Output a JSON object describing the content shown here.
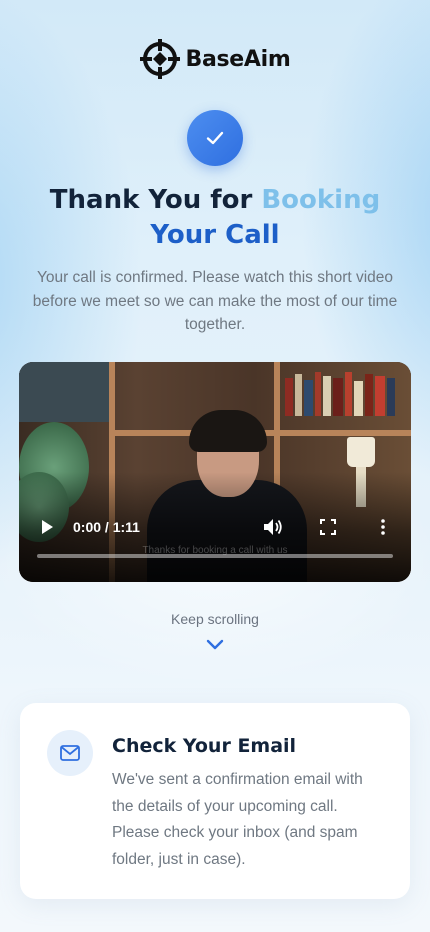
{
  "brand": {
    "name": "BaseAim",
    "icon": "crosshair-logo-icon"
  },
  "hero": {
    "check_icon": "check-icon",
    "title_part1": "Thank You for ",
    "title_part2": "Booking",
    "title_part3": "Your Call",
    "subtitle": "Your call is confirmed. Please watch this short video before we meet so we can make the most of our time together."
  },
  "video": {
    "time_display": "0:00 / 1:11",
    "progress": 0,
    "caption": "Thanks for booking a call with us",
    "controls": [
      "play-icon",
      "volume-icon",
      "fullscreen-icon",
      "more-vertical-icon"
    ]
  },
  "scroll_hint": {
    "label": "Keep scrolling",
    "icon": "chevron-down-icon"
  },
  "email_card": {
    "icon": "mail-icon",
    "title": "Check Your Email",
    "text": "We've sent a confirmation email with the details of your upcoming call. Please check your inbox (and spam folder, just in case)."
  },
  "colors": {
    "accent_blue": "#1d5fc8",
    "light_blue": "#7ec0ea",
    "check_bg": "#3a7ee8",
    "heading": "#12233a",
    "body_text": "#6f7882"
  }
}
